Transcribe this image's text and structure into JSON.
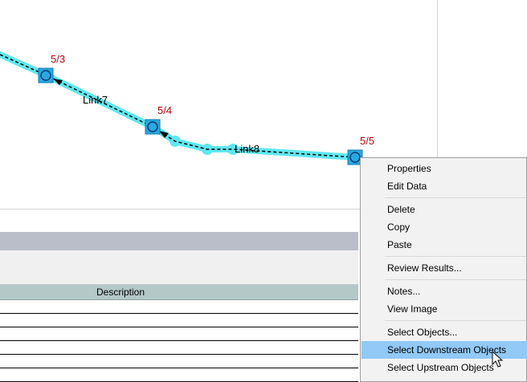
{
  "network": {
    "nodes": [
      {
        "label": "5/3"
      },
      {
        "label": "5/4"
      },
      {
        "label": "5/5"
      }
    ],
    "links": [
      {
        "label": "Link7"
      },
      {
        "label": "Link8"
      }
    ]
  },
  "grid": {
    "description_header": "Description"
  },
  "context_menu": {
    "properties": "Properties",
    "edit_data": "Edit Data",
    "delete": "Delete",
    "copy": "Copy",
    "paste": "Paste",
    "review_results": "Review Results...",
    "notes": "Notes...",
    "view_image": "View Image",
    "select_objects": "Select Objects...",
    "select_downstream": "Select Downstream Objects",
    "select_upstream": "Select Upstream Objects"
  },
  "colors": {
    "highlight": "#5de8f0",
    "node_fill": "#29a8e0",
    "node_label": "#c00000",
    "menu_highlight": "#91c9f7"
  }
}
